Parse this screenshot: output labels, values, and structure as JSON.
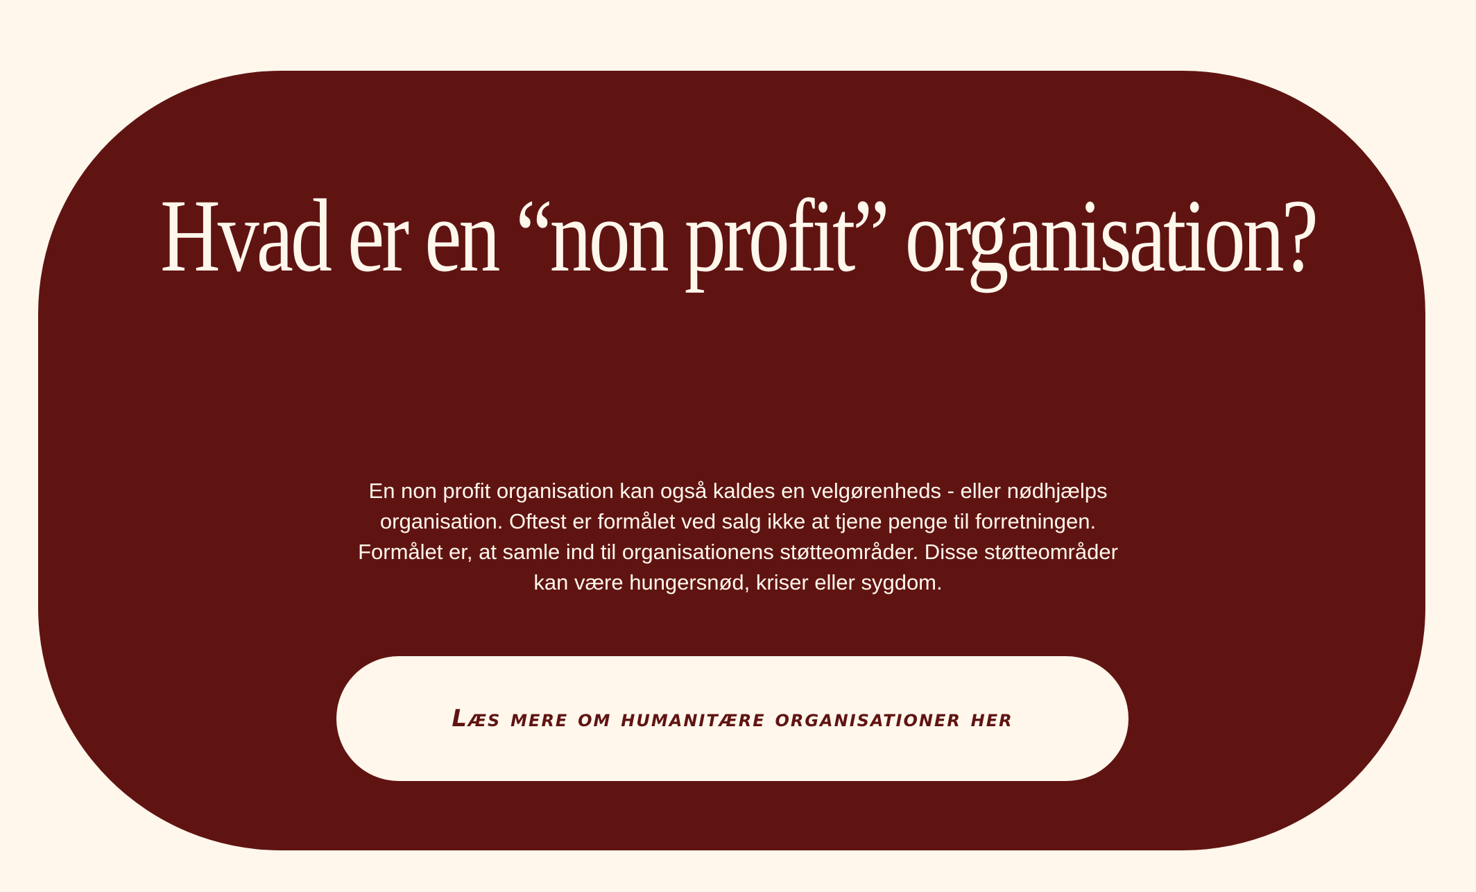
{
  "section": {
    "title": "Hvad er en “non profit” organisation?",
    "body": "En non profit organisation kan også kaldes en velgørenheds - eller nødhjælps organisation. Oftest er formålet ved salg ikke at tjene penge til forretningen. Formålet er, at samle ind til organisationens støtteområder. Disse støtteområder kan være hungersnød, kriser eller sygdom.",
    "cta_label": "Læs mere om humanitære organisationer her"
  },
  "colors": {
    "background": "#fff7ec",
    "card": "#601412",
    "text_light": "#fff7ec",
    "button_text": "#601412"
  }
}
